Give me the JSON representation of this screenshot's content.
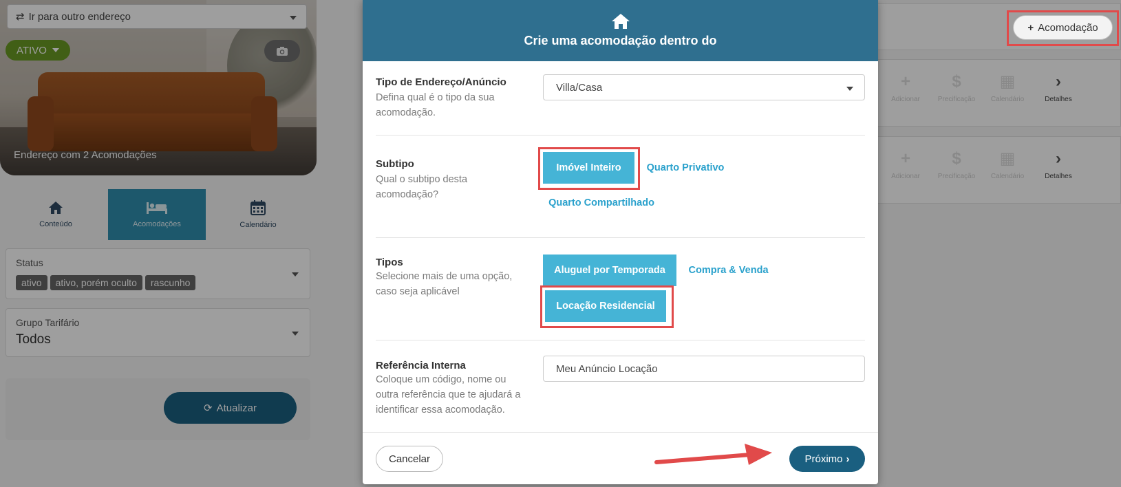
{
  "background": {
    "address_selector": {
      "label": "Ir para outro endereço"
    },
    "status_button": {
      "label": "ATIVO"
    },
    "hero_caption": "Endereço com 2 Acomodações",
    "nav_tabs": [
      {
        "label": "Conteúdo",
        "icon": "home-icon"
      },
      {
        "label": "Acomodações",
        "icon": "bed-icon",
        "active": true
      },
      {
        "label": "Calendário",
        "icon": "calendar-icon"
      }
    ],
    "status_filter": {
      "label": "Status",
      "chips": [
        "ativo",
        "ativo, porém oculto",
        "rascunho"
      ]
    },
    "grupo_filter": {
      "label": "Grupo Tarifário",
      "value": "Todos"
    },
    "refresh_button": {
      "label": "Atualizar"
    },
    "add_acomodacao_button": {
      "label": "Acomodação"
    },
    "row_actions": [
      {
        "label": "Adicionar",
        "icon": "plus-icon"
      },
      {
        "label": "Precificação",
        "icon": "dollar-icon"
      },
      {
        "label": "Calendário",
        "icon": "calendar-icon"
      },
      {
        "label": "Detalhes",
        "icon": "chevron-right-icon"
      }
    ]
  },
  "modal": {
    "title": "Crie uma acomodação dentro do",
    "header_icon": "home-icon",
    "tipo_endereco": {
      "title": "Tipo de Endereço/Anúncio",
      "description": "Defina qual é o tipo da sua acomodação.",
      "value": "Villa/Casa"
    },
    "subtipo": {
      "title": "Subtipo",
      "description": "Qual o subtipo desta acomodação?",
      "options": [
        {
          "label": "Imóvel Inteiro",
          "selected": true
        },
        {
          "label": "Quarto Privativo",
          "selected": false
        },
        {
          "label": "Quarto Compartilhado",
          "selected": false
        }
      ]
    },
    "tipos": {
      "title": "Tipos",
      "description": "Selecione mais de uma opção, caso seja aplicável",
      "options": [
        {
          "label": "Aluguel por Temporada",
          "selected": true
        },
        {
          "label": "Compra & Venda",
          "selected": false
        },
        {
          "label": "Locação Residencial",
          "selected": true
        }
      ]
    },
    "referencia": {
      "title": "Referência Interna",
      "description": "Coloque um código, nome ou outra referência que te ajudará a identificar essa acomodação.",
      "value": "Meu Anúncio Locação"
    },
    "footer": {
      "cancel_label": "Cancelar",
      "next_label": "Próximo"
    }
  },
  "colors": {
    "header": "#2f6f8f",
    "pill_selected": "#45b4d6",
    "pill_link": "#2aa1cc",
    "primary_button": "#1a5f80",
    "highlight": "#e14a4a",
    "status_green": "#6a9a24"
  }
}
